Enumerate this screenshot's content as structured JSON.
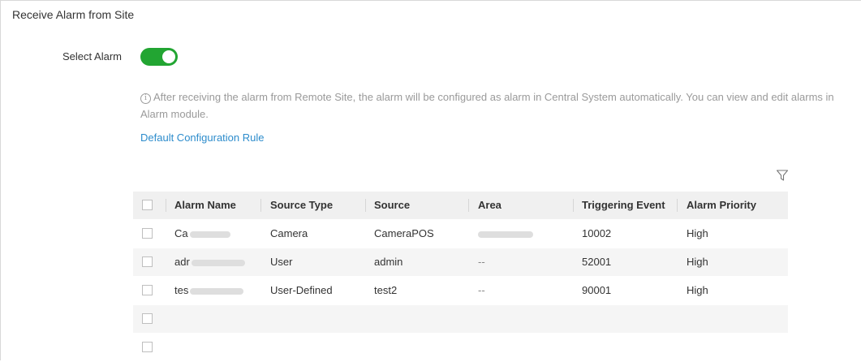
{
  "section_title": "Receive Alarm from Site",
  "select_alarm": {
    "label": "Select Alarm",
    "enabled": true,
    "on_color": "#22a532"
  },
  "info": {
    "icon": "info-circle-icon",
    "line1": "After receiving the alarm from Remote Site, the alarm will be configured as alarm in Central System automatically. You can view and edit alarms in",
    "line2": "Alarm module."
  },
  "link": {
    "label": "Default Configuration Rule",
    "color": "#2d8ccc"
  },
  "filter_icon": "filter-icon",
  "table": {
    "columns": [
      "Alarm Name",
      "Source Type",
      "Source",
      "Area",
      "Triggering Event",
      "Alarm Priority"
    ],
    "rows": [
      {
        "name": "Ca",
        "source_type": "Camera",
        "source": "CameraPOS",
        "area": "",
        "event": "10002",
        "priority": "High"
      },
      {
        "name": "adr",
        "source_type": "User",
        "source": "admin",
        "area": "--",
        "event": "52001",
        "priority": "High"
      },
      {
        "name": "tes",
        "source_type": "User-Defined",
        "source": "test2",
        "area": "--",
        "event": "90001",
        "priority": "High"
      },
      {
        "name": "",
        "source_type": "",
        "source": "",
        "area": "",
        "event": "",
        "priority": ""
      },
      {
        "name": "",
        "source_type": "",
        "source": "",
        "area": "",
        "event": "",
        "priority": ""
      }
    ]
  }
}
